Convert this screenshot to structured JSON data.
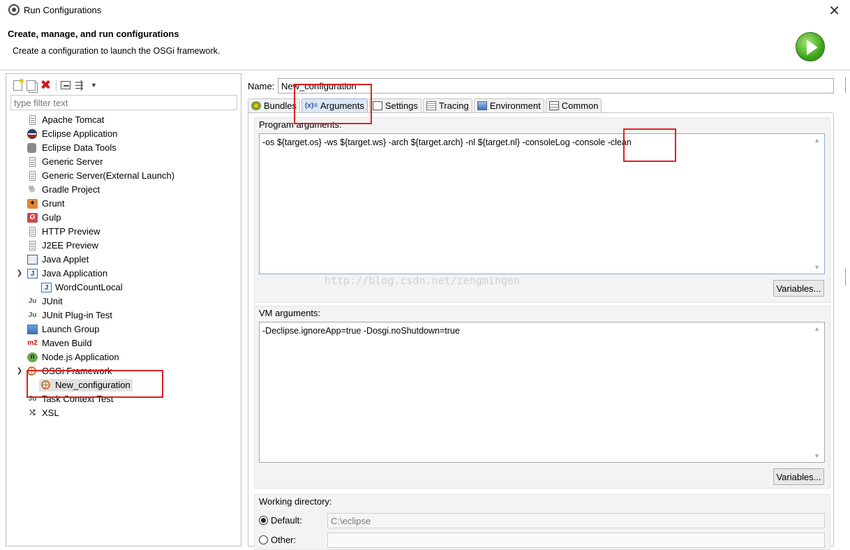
{
  "window": {
    "title": "Run Configurations",
    "close_glyph": "✕"
  },
  "header": {
    "title": "Create, manage, and run configurations",
    "description": "Create a configuration to launch the OSGi framework."
  },
  "filter": {
    "placeholder": "type filter text"
  },
  "tree": {
    "items": [
      {
        "label": "Apache Tomcat",
        "icon": "doc"
      },
      {
        "label": "Eclipse Application",
        "icon": "globe"
      },
      {
        "label": "Eclipse Data Tools",
        "icon": "db"
      },
      {
        "label": "Generic Server",
        "icon": "doc"
      },
      {
        "label": "Generic Server(External Launch)",
        "icon": "doc"
      },
      {
        "label": "Gradle Project",
        "icon": "gradle"
      },
      {
        "label": "Grunt",
        "icon": "grunt"
      },
      {
        "label": "Gulp",
        "icon": "gulp"
      },
      {
        "label": "HTTP Preview",
        "icon": "doc"
      },
      {
        "label": "J2EE Preview",
        "icon": "doc"
      },
      {
        "label": "Java Applet",
        "icon": "applet"
      },
      {
        "label": "Java Application",
        "icon": "java"
      },
      {
        "label": "WordCountLocal",
        "icon": "java"
      },
      {
        "label": "JUnit",
        "icon": "junit"
      },
      {
        "label": "JUnit Plug-in Test",
        "icon": "junit"
      },
      {
        "label": "Launch Group",
        "icon": "launch"
      },
      {
        "label": "Maven Build",
        "icon": "m2"
      },
      {
        "label": "Node.js Application",
        "icon": "node"
      },
      {
        "label": "OSGi Framework",
        "icon": "osgi"
      },
      {
        "label": "New_configuration",
        "icon": "osgi"
      },
      {
        "label": "Task Context Test",
        "icon": "junit"
      },
      {
        "label": "XSL",
        "icon": "xsl"
      }
    ]
  },
  "config": {
    "name_label": "Name:",
    "name_value": "New_configuration"
  },
  "tabs": [
    {
      "label": "Bundles",
      "icon": "bundles-icon"
    },
    {
      "label": "Arguments",
      "icon": "arguments-icon",
      "active": true
    },
    {
      "label": "Settings",
      "icon": "settings-icon"
    },
    {
      "label": "Tracing",
      "icon": "tracing-icon"
    },
    {
      "label": "Environment",
      "icon": "environment-icon"
    },
    {
      "label": "Common",
      "icon": "common-icon"
    }
  ],
  "arguments": {
    "program_label": "Program arguments:",
    "program_value": "-os ${target.os} -ws ${target.ws} -arch ${target.arch} -nl ${target.nl} -consoleLog -console -clean",
    "vm_label": "VM arguments:",
    "vm_value": "-Declipse.ignoreApp=true -Dosgi.noShutdown=true",
    "variables_label": "Variables...",
    "working_dir_label": "Working directory:",
    "default_label": "Default:",
    "default_value": "C:\\eclipse",
    "other_label": "Other:"
  },
  "watermark": "http://blog.csdn.net/zengmingen",
  "colors": {
    "annotation": "#e02020",
    "active_tab": "#dde6f3",
    "run_icon": "#3fa61a"
  }
}
